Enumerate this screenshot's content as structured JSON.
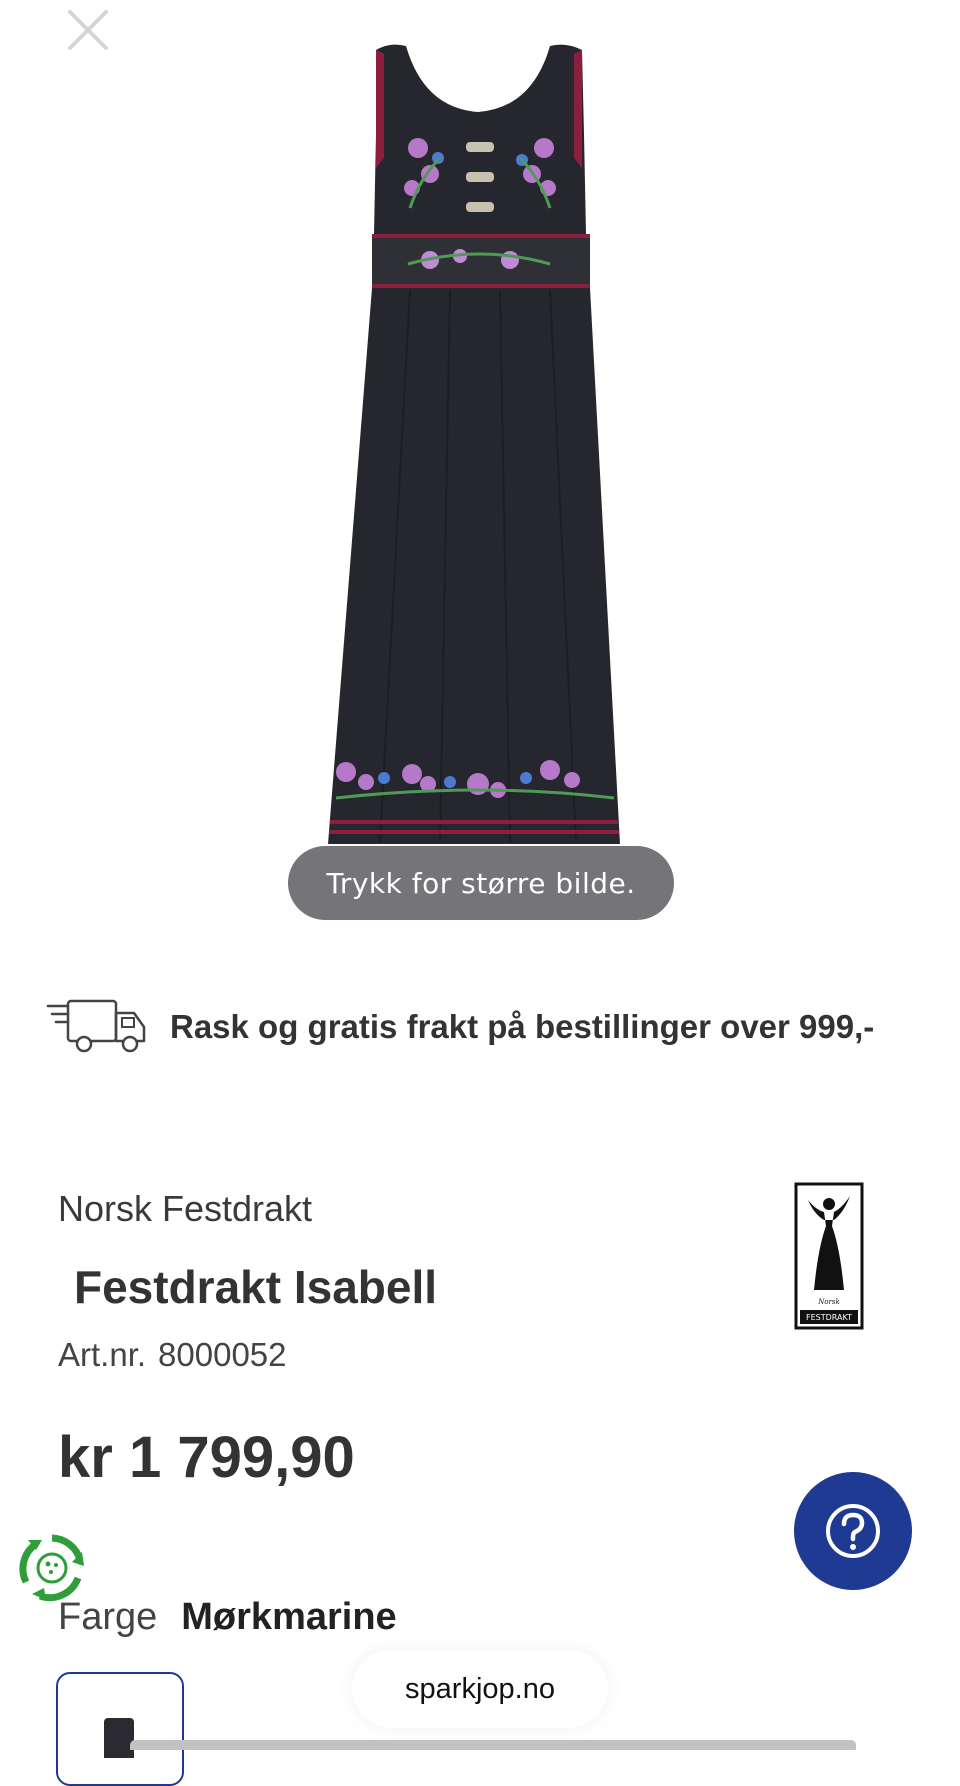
{
  "gallery": {
    "zoom_hint": "Trykk for større bilde."
  },
  "shipping": {
    "icon": "delivery-truck-icon",
    "text": "Rask og gratis frakt på bestillinger over 999,-"
  },
  "product": {
    "brand": "Norsk Festdrakt",
    "title": "Festdrakt Isabell",
    "artnr_label": "Art.nr.",
    "artnr_value": "8000052",
    "price": "kr 1 799,90",
    "color_label": "Farge",
    "color_value": "Mørkmarine",
    "brand_logo_text_top": "Norsk",
    "brand_logo_text_bottom": "FESTDRAKT"
  },
  "help": {
    "icon": "question-mark-icon"
  },
  "browser": {
    "url": "sparkjop.no"
  },
  "colors": {
    "accent": "#1f3a93",
    "eco_green": "#2e9d3a",
    "dress_fabric": "#26272e",
    "trim": "#8c1f3d"
  }
}
